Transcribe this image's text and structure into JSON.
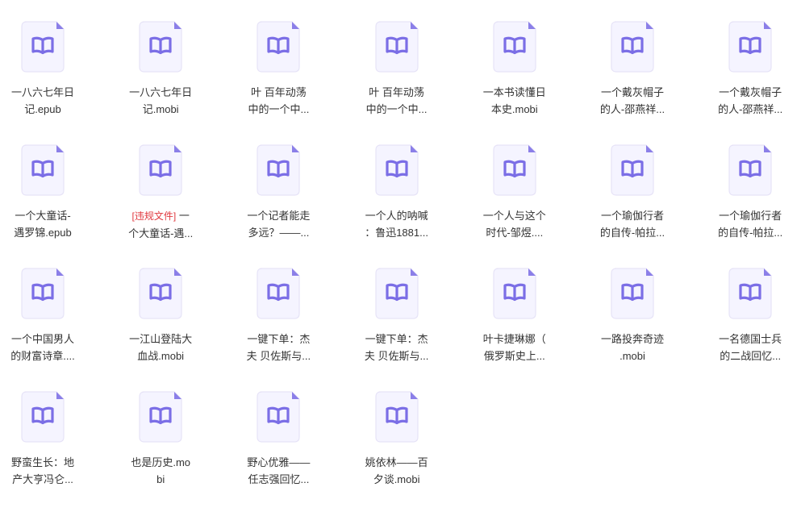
{
  "colors": {
    "page_bg": "#ffffff",
    "icon_page": "#f5f4ff",
    "icon_border": "#e6e3f7",
    "icon_fold": "#8b7fe8",
    "icon_book": "#7b6ee6",
    "text": "#333333",
    "violation": "#e0383e"
  },
  "icon_name": "ebook-file-icon",
  "files": [
    {
      "line1": "一八六七年日",
      "line2": "记.epub"
    },
    {
      "line1": "一八六七年日",
      "line2": "记.mobi"
    },
    {
      "line1": "叶 百年动荡",
      "line2": "中的一个中..."
    },
    {
      "line1": "叶 百年动荡",
      "line2": "中的一个中..."
    },
    {
      "line1": "一本书读懂日",
      "line2": "本史.mobi"
    },
    {
      "line1": "一个戴灰帽子",
      "line2": "的人-邵燕祥..."
    },
    {
      "line1": "一个戴灰帽子",
      "line2": "的人-邵燕祥..."
    },
    {
      "line1": "一个大童话-",
      "line2": "遇罗锦.epub"
    },
    {
      "tag": "[违规文件]",
      "line1": " 一",
      "line2": "个大童话-遇..."
    },
    {
      "line1": "一个记者能走",
      "line2": "多远？——..."
    },
    {
      "line1": "一个人的呐喊",
      "line2": "：鲁迅1881..."
    },
    {
      "line1": "一个人与这个",
      "line2": "时代-邹煜...."
    },
    {
      "line1": "一个瑜伽行者",
      "line2": "的自传-帕拉..."
    },
    {
      "line1": "一个瑜伽行者",
      "line2": "的自传-帕拉..."
    },
    {
      "line1": "一个中国男人",
      "line2": "的财富诗章...."
    },
    {
      "line1": "一江山登陆大",
      "line2": "血战.mobi"
    },
    {
      "line1": "一键下单：杰",
      "line2": "夫 贝佐斯与..."
    },
    {
      "line1": "一键下单：杰",
      "line2": "夫 贝佐斯与..."
    },
    {
      "line1": "叶卡捷琳娜（",
      "line2": "俄罗斯史上..."
    },
    {
      "line1": "一路投奔奇迹",
      "line2": ".mobi"
    },
    {
      "line1": "一名德国士兵",
      "line2": "的二战回忆..."
    },
    {
      "line1": "野蛮生长：地",
      "line2": "产大亨冯仑..."
    },
    {
      "line1": "也是历史.mo",
      "line2": "bi"
    },
    {
      "line1": "野心优雅——",
      "line2": "任志强回忆..."
    },
    {
      "line1": "姚依林——百",
      "line2": "夕谈.mobi"
    }
  ]
}
